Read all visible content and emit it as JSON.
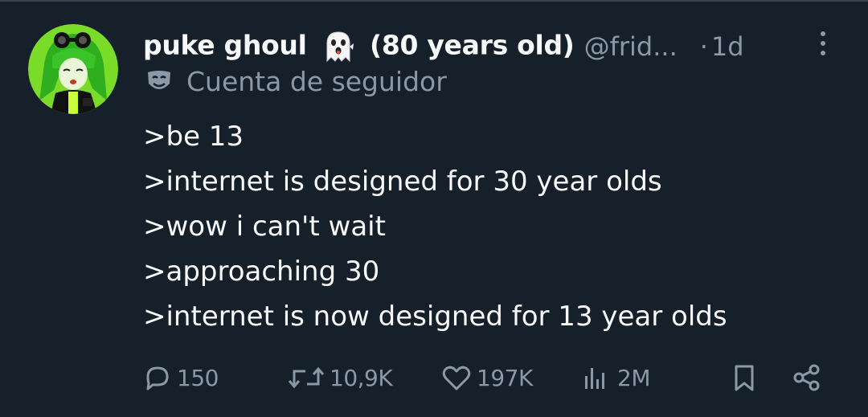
{
  "post": {
    "author_name_prefix": "puke ghoul",
    "author_name_suffix": "(80 years old)",
    "author_emoji": "ghost-icon",
    "handle": "@frid...",
    "separator": "·",
    "time": "1d",
    "account_label": "Cuenta de seguidor",
    "account_icon": "theater-mask-icon",
    "body_lines": [
      ">be 13",
      ">internet is designed for 30 year olds",
      ">wow i can't wait",
      ">approaching 30",
      ">internet is now designed for 13 year olds"
    ]
  },
  "actions": {
    "replies": "150",
    "reposts": "10,9K",
    "likes": "197K",
    "views": "2M"
  },
  "colors": {
    "background": "#15202b",
    "text": "#f7f9f9",
    "muted": "#8b98a5",
    "avatar_accent": "#7ed321"
  }
}
